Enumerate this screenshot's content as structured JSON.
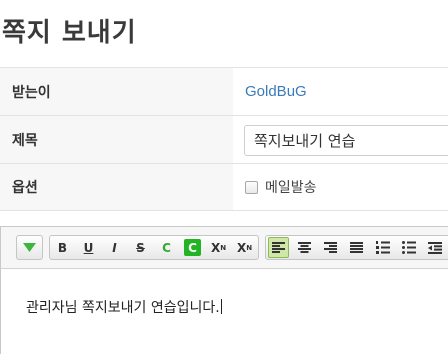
{
  "page": {
    "title": "쪽지 보내기"
  },
  "form": {
    "recipient": {
      "label": "받는이",
      "value": "GoldBuG"
    },
    "subject": {
      "label": "제목",
      "value": "쪽지보내기 연습"
    },
    "options": {
      "label": "옵션",
      "checkbox_label": "메일발송",
      "checked": false
    }
  },
  "toolbar": {
    "bold": "B",
    "underline": "U",
    "italic": "I",
    "strike": "S",
    "text_color": "C",
    "bg_color": "C",
    "superscript_base": "X",
    "superscript_mark": "N",
    "subscript_base": "X",
    "subscript_mark": "N"
  },
  "editor": {
    "content": "관리자님 쪽지보내기 연습입니다."
  },
  "colors": {
    "link": "#3a7bb8",
    "active_button": "#cfe8a8",
    "green": "#22b422"
  }
}
